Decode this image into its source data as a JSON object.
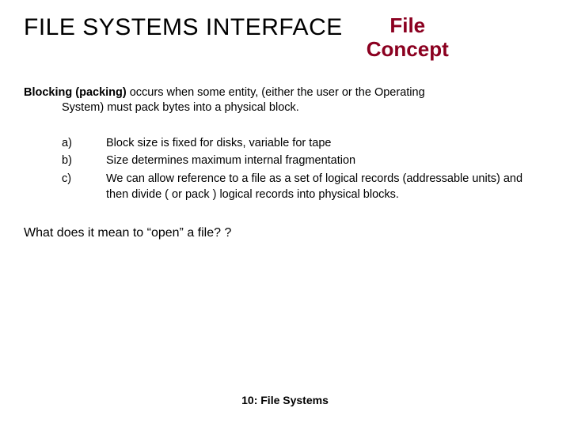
{
  "header": {
    "main_title": "FILE SYSTEMS INTERFACE",
    "side_title_line1": "File",
    "side_title_line2": "Concept"
  },
  "body": {
    "para_bold": "Blocking (packing)",
    "para_rest_line1": " occurs when some entity, (either the user or the Operating",
    "para_rest_line2": "System) must pack bytes into a physical block.",
    "list": [
      {
        "marker": "a)",
        "text": "Block size is fixed for disks, variable for tape"
      },
      {
        "marker": "b)",
        "text": "Size determines maximum internal fragmentation"
      },
      {
        "marker": "c)",
        "text": "We can allow reference to a file as a set of logical records (addressable units) and then divide ( or pack ) logical records into physical blocks."
      }
    ],
    "question": "What does it mean to “open” a file? ?"
  },
  "footer": {
    "text": "10: File Systems"
  }
}
